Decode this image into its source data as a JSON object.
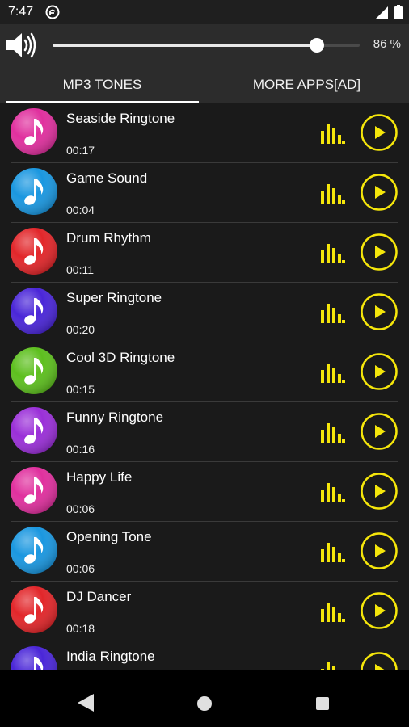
{
  "status_bar": {
    "time": "7:47",
    "mode_icon": "do-not-disturb-icon",
    "signal_icon": "signal-icon",
    "battery_icon": "battery-icon"
  },
  "volume": {
    "speaker_icon": "speaker-icon",
    "level": 0.86,
    "text": "86 %"
  },
  "tabs": [
    {
      "label": "MP3 TONES",
      "active": true
    },
    {
      "label": "MORE APPS[AD]",
      "active": false
    }
  ],
  "accent_color": "#f5e60b",
  "ringtones": [
    {
      "title": "Seaside Ringtone",
      "duration": "00:17",
      "color": "#e0309e"
    },
    {
      "title": "Game Sound",
      "duration": "00:04",
      "color": "#1a97e0"
    },
    {
      "title": "Drum Rhythm",
      "duration": "00:11",
      "color": "#e2262a"
    },
    {
      "title": "Super Ringtone",
      "duration": "00:20",
      "color": "#4a26d8"
    },
    {
      "title": "Cool 3D Ringtone",
      "duration": "00:15",
      "color": "#5dbf1e"
    },
    {
      "title": "Funny Ringtone",
      "duration": "00:16",
      "color": "#9a2fd8"
    },
    {
      "title": "Happy Life",
      "duration": "00:06",
      "color": "#e0309e"
    },
    {
      "title": "Opening Tone",
      "duration": "00:06",
      "color": "#1a97e0"
    },
    {
      "title": "DJ Dancer",
      "duration": "00:18",
      "color": "#e2262a"
    },
    {
      "title": "India Ringtone",
      "duration": "",
      "color": "#4a26d8"
    }
  ],
  "nav": {
    "back_icon": "back-icon",
    "home_icon": "home-icon",
    "recents_icon": "recents-icon"
  }
}
